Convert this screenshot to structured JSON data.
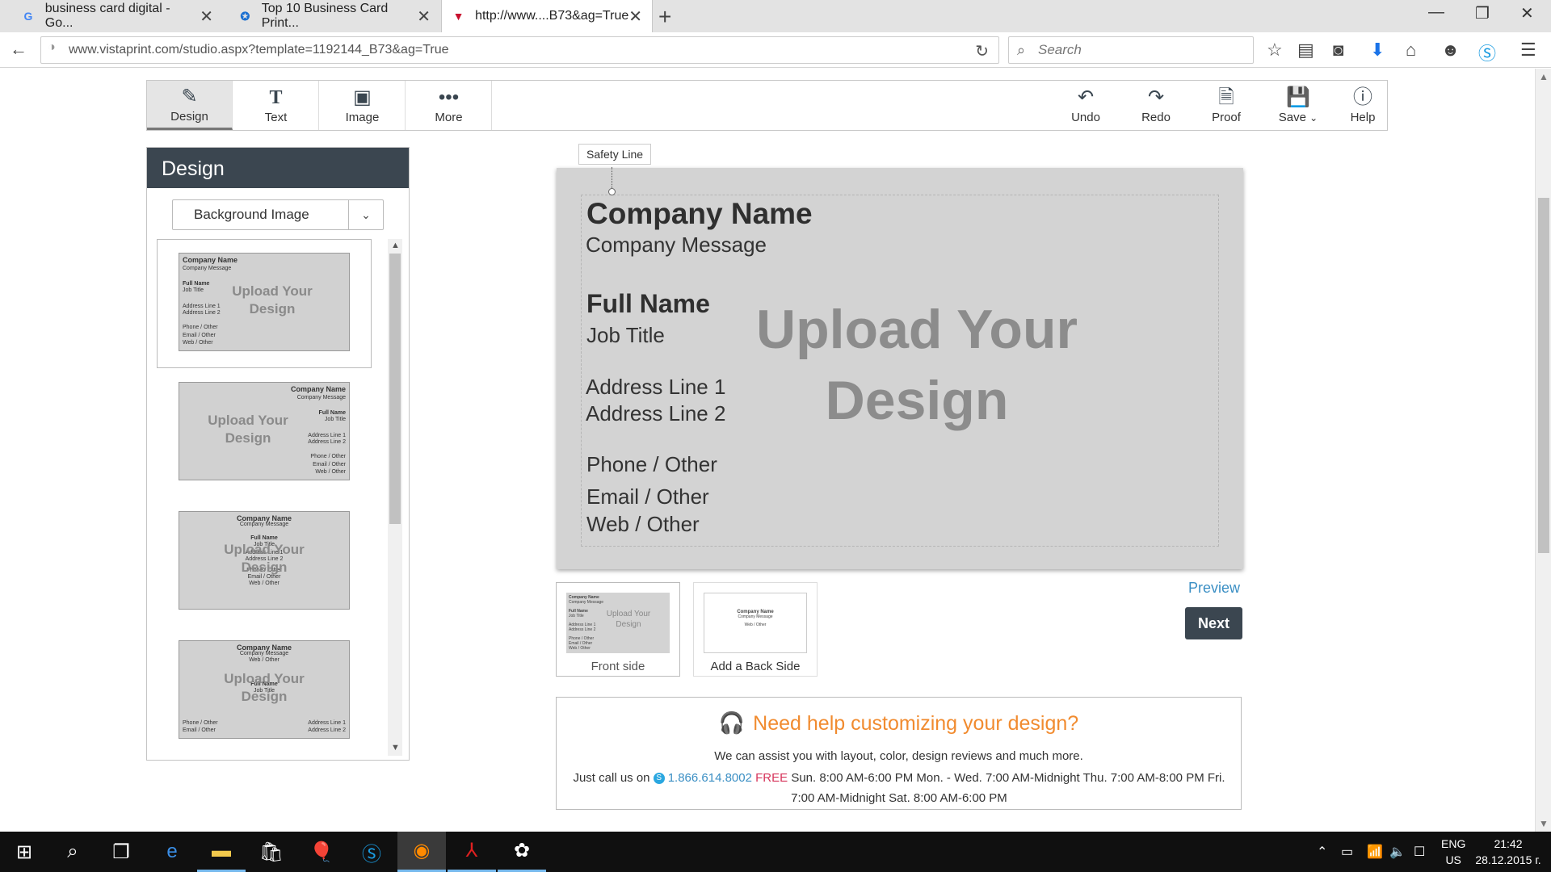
{
  "browser": {
    "tabs": [
      {
        "title": "business card digital - Go...",
        "icon": "google-icon"
      },
      {
        "title": "Top 10 Business Card Print...",
        "icon": "site-icon"
      },
      {
        "title": "http://www....B73&ag=True",
        "icon": "vistaprint-icon"
      }
    ],
    "url": "www.vistaprint.com/studio.aspx?template=1192144_B73&ag=True",
    "search_placeholder": "Search"
  },
  "toolbar": {
    "left": [
      {
        "label": "Design",
        "icon": "pencil-icon"
      },
      {
        "label": "Text",
        "icon": "text-icon"
      },
      {
        "label": "Image",
        "icon": "image-icon"
      },
      {
        "label": "More",
        "icon": "more-icon"
      }
    ],
    "right": [
      {
        "label": "Undo",
        "icon": "undo-icon"
      },
      {
        "label": "Redo",
        "icon": "redo-icon"
      },
      {
        "label": "Proof",
        "icon": "proof-icon"
      },
      {
        "label": "Save",
        "icon": "save-icon"
      },
      {
        "label": "Help",
        "icon": "help-icon"
      }
    ]
  },
  "design_panel": {
    "title": "Design",
    "dropdown_value": "Background Image",
    "thumb": {
      "company": "Company Name",
      "message": "Company Message",
      "full_name": "Full Name",
      "job": "Job Title",
      "addr1": "Address Line 1",
      "addr2": "Address Line 2",
      "phone": "Phone / Other",
      "email": "Email / Other",
      "web": "Web / Other",
      "upload_line1": "Upload Your",
      "upload_line2": "Design"
    }
  },
  "canvas": {
    "safety_label": "Safety Line",
    "company": "Company Name",
    "message": "Company Message",
    "full_name": "Full Name",
    "job": "Job Title",
    "addr1": "Address Line 1",
    "addr2": "Address Line 2",
    "phone": "Phone / Other",
    "email": "Email / Other",
    "web": "Web / Other",
    "upload_line1": "Upload Your",
    "upload_line2": "Design"
  },
  "sides": {
    "front_label": "Front side",
    "back_label": "Add a Back Side",
    "back_company": "Company Name",
    "back_message": "Company Message",
    "back_web": "Web / Other"
  },
  "actions": {
    "preview": "Preview",
    "next": "Next"
  },
  "help": {
    "heading": "Need help customizing your design?",
    "sub": "We can assist you with layout, color, design reviews and much more.",
    "call_prefix": "Just call us on",
    "phone": "1.866.614.8002",
    "free": "FREE",
    "hours": "Sun. 8:00 AM-6:00 PM Mon. - Wed. 7:00 AM-Midnight Thu. 7:00 AM-8:00 PM Fri. 7:00 AM-Midnight Sat. 8:00 AM-6:00 PM"
  },
  "taskbar": {
    "lang_line1": "ENG",
    "lang_line2": "US",
    "time": "21:42",
    "date": "28.12.2015 г."
  }
}
